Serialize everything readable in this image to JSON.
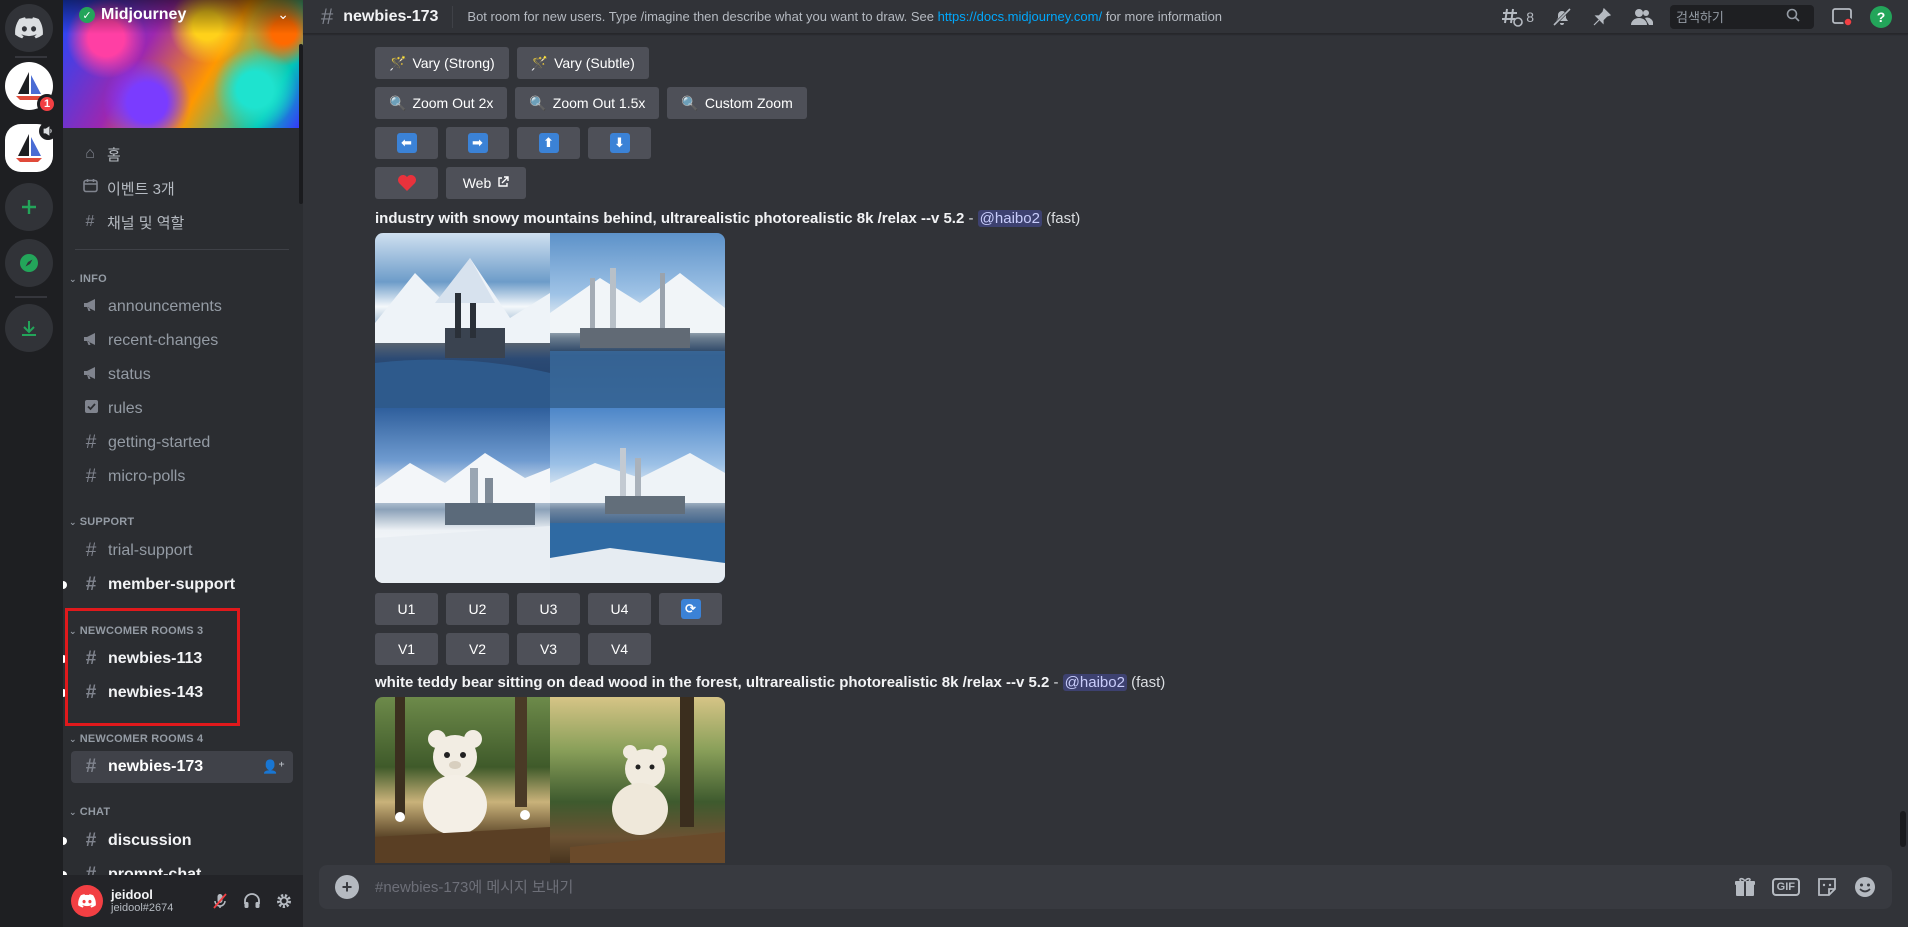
{
  "server": {
    "name": "Midjourney"
  },
  "rail": {
    "badge": "1"
  },
  "sidebar": {
    "nav": [
      {
        "label": "홈"
      },
      {
        "label": "이벤트 3개"
      },
      {
        "label": "채널 및 역할"
      }
    ],
    "categories": {
      "info": "INFO",
      "support": "SUPPORT",
      "newcomer3": "NEWCOMER ROOMS 3",
      "newcomer4": "NEWCOMER ROOMS 4",
      "chat": "CHAT"
    },
    "info_channels": [
      "announcements",
      "recent-changes",
      "status",
      "rules",
      "getting-started",
      "micro-polls"
    ],
    "support_channels": [
      "trial-support",
      "member-support"
    ],
    "newcomer3_channels": [
      "newbies-113",
      "newbies-143"
    ],
    "newcomer4_channels": [
      "newbies-173"
    ],
    "chat_channels": [
      "discussion",
      "prompt-chat"
    ]
  },
  "user": {
    "name": "jeidool",
    "tag": "jeidool#2674"
  },
  "header": {
    "channel": "newbies-173",
    "topic_text": "Bot room for new users. Type /imagine then describe what you want to draw. See ",
    "topic_link": "https://docs.midjourney.com/",
    "topic_suffix": " for more information",
    "thread_count": "8",
    "search_placeholder": "검색하기"
  },
  "messages": {
    "row1": [
      "Vary (Strong)",
      "Vary (Subtle)"
    ],
    "row2": [
      "Zoom Out 2x",
      "Zoom Out 1.5x",
      "Custom Zoom"
    ],
    "web_label": "Web",
    "prompt1": {
      "text": "industry with snowy mountains behind, ultrarealistic photorealistic 8k /relax --v 5.2",
      "dash": " - ",
      "mention": "@haibo2",
      "mode": " (fast)"
    },
    "upscale": [
      "U1",
      "U2",
      "U3",
      "U4"
    ],
    "variation": [
      "V1",
      "V2",
      "V3",
      "V4"
    ],
    "prompt2": {
      "text": "white teddy bear sitting on dead wood in the forest, ultrarealistic photorealistic 8k /relax --v 5.2",
      "dash": " - ",
      "mention": "@haibo2",
      "mode": " (fast)"
    }
  },
  "composer": {
    "placeholder": "#newbies-173에 메시지 보내기",
    "gif_label": "GIF"
  },
  "colors": {
    "accent": "#5865f2",
    "highlight": "#e0191c",
    "online": "#23a55a",
    "danger": "#f23f43"
  }
}
